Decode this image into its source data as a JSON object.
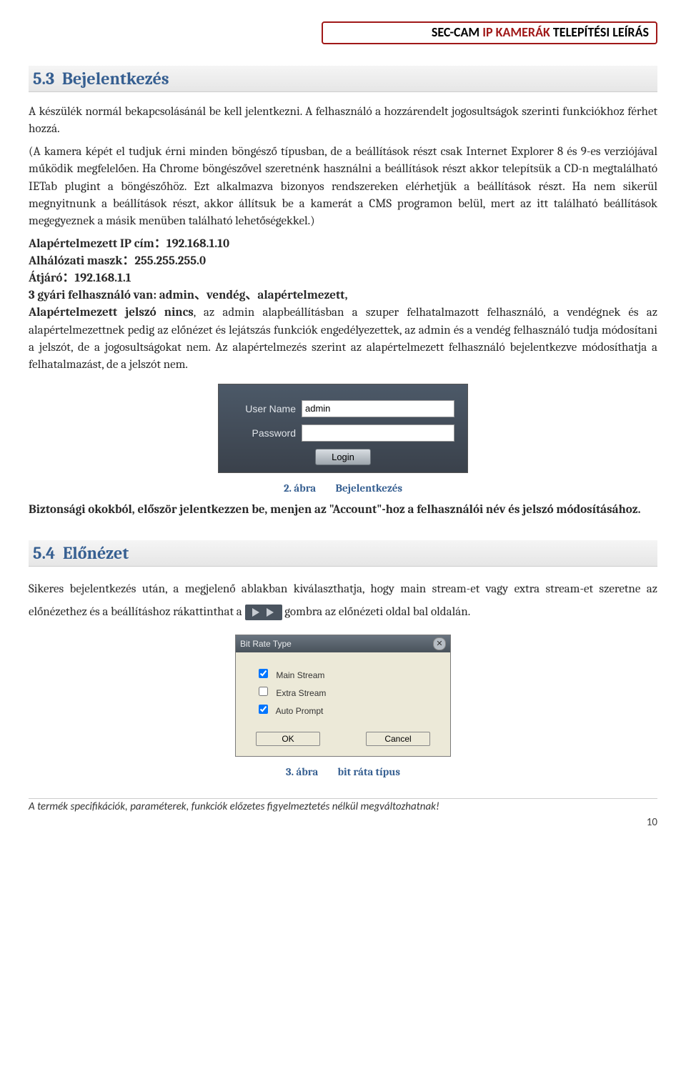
{
  "header": {
    "part1": "SEC-CAM ",
    "part2_red": "IP KAMERÁK ",
    "part3": "TELEPÍTÉSI LEÍRÁS"
  },
  "section1": {
    "number": "5.3",
    "title": "Bejelentkezés",
    "paragraph1": "A készülék normál bekapcsolásánál be kell jelentkezni. A felhasználó a hozzárendelt jogosultságok szerinti funkciókhoz férhet hozzá.",
    "paragraph2": "(A kamera képét el tudjuk érni minden böngésző típusban, de a beállítások részt csak Internet Explorer 8 és 9-es verziójával működik megfelelően. Ha Chrome böngészővel szeretnénk használni a beállítások részt akkor telepítsük a CD-n megtalálható IETab plugint a böngészőhöz. Ezt alkalmazva bizonyos rendszereken elérhetjük a beállítások részt. Ha nem sikerül megnyitnunk a beállítások részt, akkor állítsuk be a kamerát a CMS programon belül, mert az itt található beállítások megegyeznek a másik menüben található lehetőségekkel.)",
    "default_ip_line": "Alapértelmezett IP cím：192.168.1.10",
    "subnet_line": "Alhálózati maszk：255.255.255.0",
    "gateway_line": "Átjáró：192.168.1.1",
    "users_intro": "3 gyári felhasználó van: admin、vendég、alapértelmezett,",
    "users_span_bold": "Alapértelmezett jelszó nincs",
    "users_rest": ", az admin alapbeállításban a szuper felhatalmazott felhasználó, a vendégnek és az alapértelmezettnek pedig az előnézet és lejátszás funkciók engedélyezettek, az admin és a vendég felhasználó tudja módosítani a jelszót, de a jogosultságokat nem. Az alapértelmezés szerint az alapértelmezett felhasználó bejelentkezve módosíthatja a felhatalmazást, de a jelszót nem."
  },
  "login": {
    "username_label": "User Name",
    "password_label": "Password",
    "username_value": "admin",
    "button_label": "Login"
  },
  "figure1": {
    "num": "2. ábra",
    "title": "Bejelentkezés"
  },
  "security_note": "Biztonsági okokból, először jelentkezzen be, menjen az \"Account\"-hoz a felhasználói név és jelszó módosításához.",
  "section2": {
    "number": "5.4",
    "title": "Előnézet",
    "paragraph_a": "Sikeres bejelentkezés után, a megjelenő ablakban kiválaszthatja, hogy main stream-et vagy extra stream-et szeretne az előnézethez és a beállításhoz rákattinthat a ",
    "paragraph_b": " gombra az előnézeti oldal bal oldalán."
  },
  "dialog": {
    "title": "Bit Rate Type",
    "options": {
      "main": {
        "label": "Main Stream",
        "checked": true
      },
      "extra": {
        "label": "Extra Stream",
        "checked": false
      },
      "auto": {
        "label": "Auto Prompt",
        "checked": true
      }
    },
    "ok": "OK",
    "cancel": "Cancel"
  },
  "figure2": {
    "num": "3. ábra",
    "title": "bit ráta típus"
  },
  "footer": "A termék specifikációk, paraméterek, funkciók előzetes figyelmeztetés nélkül megváltozhatnak!",
  "page_number": "10"
}
